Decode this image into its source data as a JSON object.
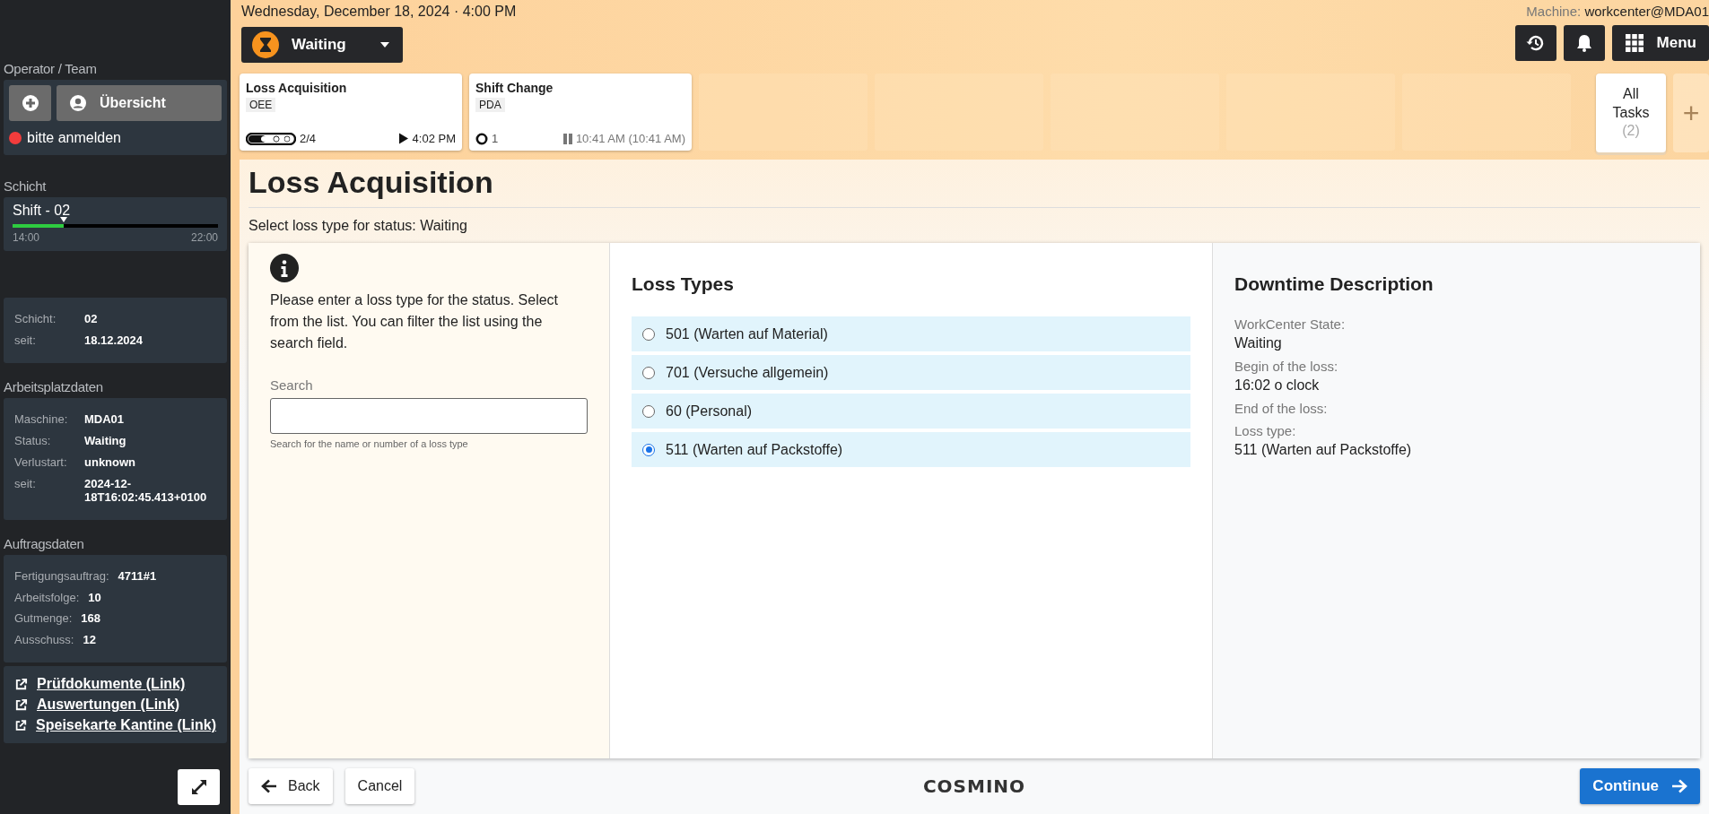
{
  "sidebar": {
    "operator": {
      "heading": "Operator / Team",
      "overview_button": "Übersicht",
      "login_status": "bitte anmelden"
    },
    "shift": {
      "heading": "Schicht",
      "name": "Shift - 02",
      "level": 0.25,
      "start": "14:00",
      "end": "22:00"
    },
    "shift_info": [
      {
        "label": "Schicht:",
        "value": "02"
      },
      {
        "label": "seit:",
        "value": "18.12.2024"
      }
    ],
    "workplace": {
      "heading": "Arbeitsplatzdaten",
      "rows": [
        {
          "label": "Maschine:",
          "value": "MDA01"
        },
        {
          "label": "Status:",
          "value": "Waiting"
        },
        {
          "label": "Verlustart:",
          "value": "unknown"
        },
        {
          "label": "seit:",
          "value": "2024-12-18T16:02:45.413+0100"
        }
      ]
    },
    "order": {
      "heading": "Auftragsdaten",
      "rows": [
        {
          "label": "Fertigungsauftrag:",
          "value": "4711#1"
        },
        {
          "label": "Arbeitsfolge:",
          "value": "10"
        },
        {
          "label": "Gutmenge:",
          "value": "168"
        },
        {
          "label": "Ausschuss:",
          "value": "12"
        }
      ]
    },
    "links": [
      "Prüfdokumente (Link)",
      "Auswertungen (Link)",
      "Speisekarte Kantine (Link)"
    ]
  },
  "header": {
    "date": "Wednesday, December 18, 2024 · 4:00 PM",
    "machine_label": "Machine:",
    "machine_value": "workcenter@MDA01",
    "status_button": "Waiting",
    "menu_button": "Menu"
  },
  "tasks": [
    {
      "title": "Loss Acquisition",
      "tag": "OEE",
      "steps": {
        "kind": "pill",
        "text": "2/4"
      },
      "timer": {
        "kind": "running",
        "text": "4:02 PM"
      }
    },
    {
      "title": "Shift Change",
      "tag": "PDA",
      "steps": {
        "kind": "ring",
        "text": "1"
      },
      "timer": {
        "kind": "paused",
        "text": "10:41 AM (10:41 AM)"
      }
    }
  ],
  "all_tasks": {
    "label": "All Tasks",
    "count": "(2)",
    "add": "+"
  },
  "page": {
    "title": "Loss Acquisition",
    "subtitle": "Select loss type for status: Waiting"
  },
  "instructions": {
    "text": "Please enter a loss type for the status. Select from the list. You can filter the list using the search field.",
    "search_label": "Search",
    "search_hint": "Search for the name or number of a loss type"
  },
  "loss_types": {
    "heading": "Loss Types",
    "options": [
      {
        "label": "501 (Warten auf Material)",
        "selected": false
      },
      {
        "label": "701 (Versuche allgemein)",
        "selected": false
      },
      {
        "label": "60 (Personal)",
        "selected": false
      },
      {
        "label": "511 (Warten auf Packstoffe)",
        "selected": true
      }
    ]
  },
  "description": {
    "heading": "Downtime Description",
    "fields": [
      {
        "label": "WorkCenter State:",
        "value": "Waiting"
      },
      {
        "label": "Begin of the loss:",
        "value": "16:02 o clock"
      },
      {
        "label": "End of the loss:"
      },
      {
        "label": "Loss type:",
        "value": "511 (Warten auf Packstoffe)"
      }
    ]
  },
  "footer": {
    "back": "Back",
    "cancel": "Cancel",
    "logo": "COSMINO",
    "continue": "Continue"
  }
}
